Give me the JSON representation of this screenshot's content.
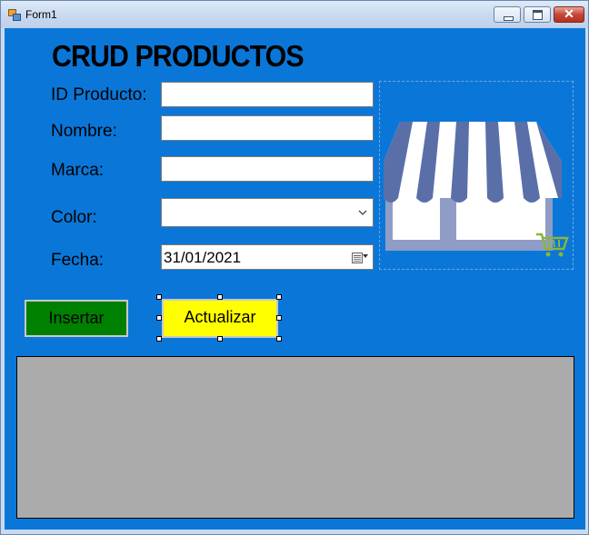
{
  "window": {
    "title": "Form1"
  },
  "form": {
    "heading": "CRUD PRODUCTOS",
    "labels": {
      "id": "ID Producto:",
      "nombre": "Nombre:",
      "marca": "Marca:",
      "color": "Color:",
      "fecha": "Fecha:"
    },
    "values": {
      "id": "",
      "nombre": "",
      "marca": "",
      "color": "",
      "fecha": "31/01/2021"
    },
    "buttons": {
      "insert": "Insertar",
      "update": "Actualizar"
    }
  },
  "icons": {
    "store": "storefront-awning-icon",
    "cart": "shopping-cart-icon",
    "calendar": "calendar-dropdown-icon",
    "combo_arrow": "chevron-down-icon"
  },
  "colors": {
    "client_background": "#0a77d8",
    "insert_button": "#008000",
    "update_button": "#ffff00",
    "grid_background": "#ababab",
    "awning_stripe": "#5a6fa8",
    "cart": "#8cb43a"
  }
}
